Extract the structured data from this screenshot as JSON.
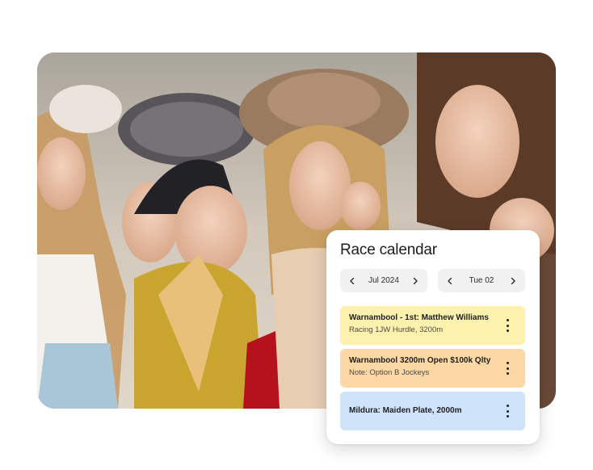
{
  "calendar": {
    "title": "Race calendar",
    "month": {
      "value": "Jul 2024",
      "prev_icon": "chevron-left-icon",
      "next_icon": "chevron-right-icon"
    },
    "day": {
      "value": "Tue 02",
      "prev_icon": "chevron-left-icon",
      "next_icon": "chevron-right-icon"
    },
    "events": [
      {
        "title": "Warnambool - 1st: Matthew Williams",
        "subtitle": "Racing 1JW Hurdle, 3200m",
        "color": "#fdf1ae"
      },
      {
        "title": "Warnambool 3200m Open $100k Qlty",
        "subtitle": "Note: Option B Jockeys",
        "color": "#fcd8a4"
      },
      {
        "title": "Mildura: Maiden Plate, 2000m",
        "subtitle": "",
        "color": "#cfe3fb"
      }
    ],
    "menu_icon": "more-vertical-icon"
  }
}
